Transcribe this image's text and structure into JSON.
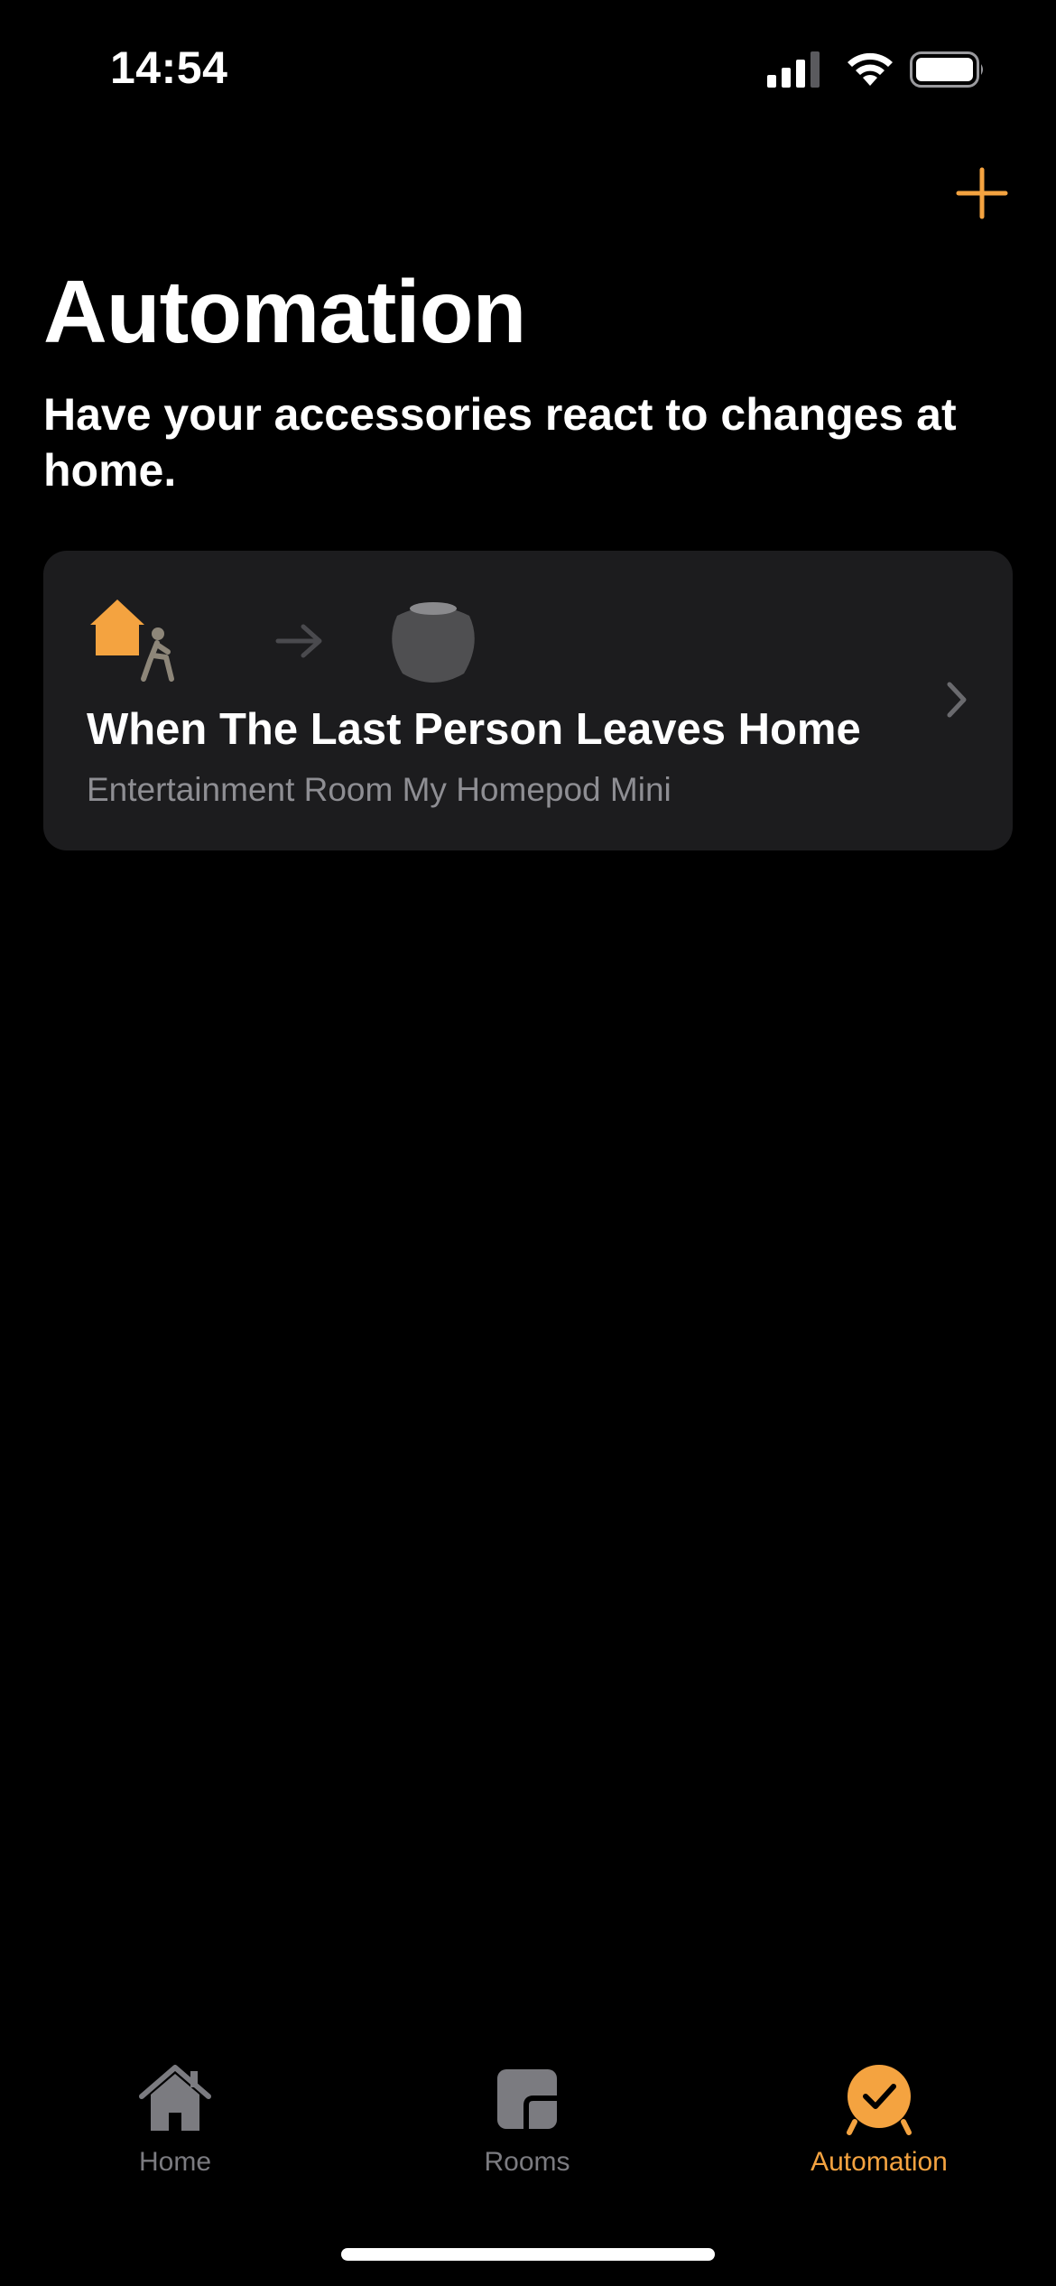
{
  "status_bar": {
    "time": "14:54"
  },
  "header": {
    "add_icon": "plus-icon",
    "title": "Automation",
    "subtitle": "Have your accessories react to changes at home."
  },
  "automations": [
    {
      "title": "When The Last Person Leaves Home",
      "subtitle": "Entertainment Room My Homepod Mini",
      "trigger_icon": "house-person-leaving-icon",
      "accessory_icon": "homepod-mini-icon"
    }
  ],
  "tabs": [
    {
      "label": "Home",
      "icon": "house-icon",
      "selected": false
    },
    {
      "label": "Rooms",
      "icon": "rooms-icon",
      "selected": false
    },
    {
      "label": "Automation",
      "icon": "clock-check-icon",
      "selected": true
    }
  ],
  "colors": {
    "accent": "#f4a340",
    "background": "#000000",
    "card": "#1c1c1e",
    "secondary_text": "#8e8e93",
    "inactive_tab": "#7b7b80"
  }
}
